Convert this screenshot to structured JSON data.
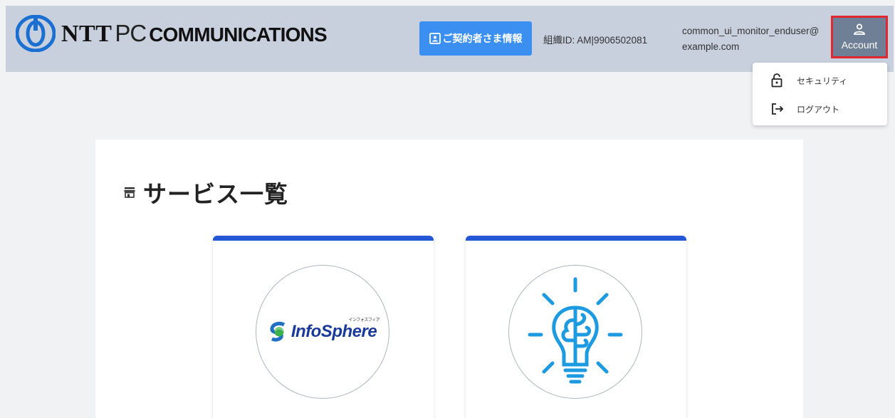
{
  "header": {
    "logo": {
      "brand": "NTT",
      "brand_pc": "PC",
      "brand_comm": "COMMUNICATIONS"
    },
    "contract_button_label": "ご契約者さま情報",
    "org_id": "組織ID: AM|9906502081",
    "user_email": "common_ui_monitor_enduser@example.com",
    "account_button_label": "Account"
  },
  "account_menu": {
    "items": [
      {
        "label": "セキュリティ",
        "icon": "lock-icon"
      },
      {
        "label": "ログアウト",
        "icon": "logout-icon"
      }
    ]
  },
  "main": {
    "title": "サービス一覧",
    "title_icon": "store-icon",
    "cards": [
      {
        "logo_text": "InfoSphere",
        "logo_sub": "インフォスフィア"
      },
      {
        "icon": "lightbulb-brain-icon"
      }
    ]
  },
  "colors": {
    "header_bg": "#c8d0de",
    "contract_button": "#3a8ff0",
    "account_button": "#6f8096",
    "highlight_border": "#e0282e",
    "card_accent": "#2456d6",
    "icon_blue": "#1e9be0"
  }
}
